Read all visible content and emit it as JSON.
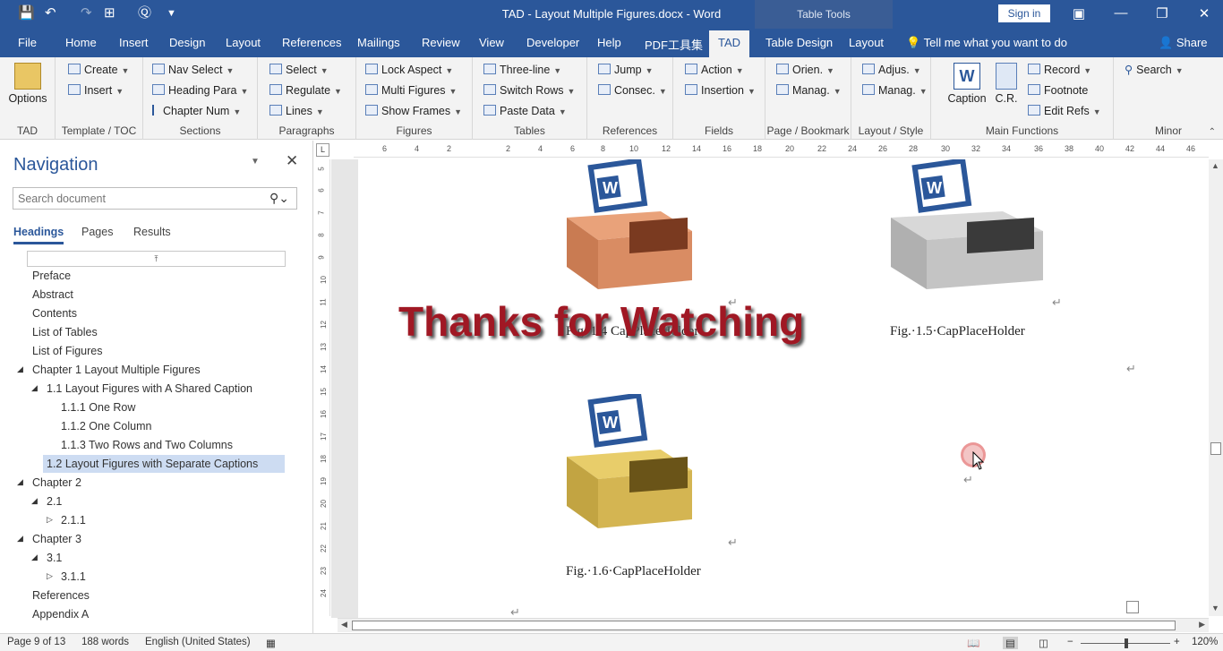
{
  "app": {
    "doc_title": "TAD - Layout Multiple Figures.docx  -  Word",
    "table_tools": "Table Tools",
    "sign_in": "Sign in"
  },
  "tabs": [
    "File",
    "Home",
    "Insert",
    "Design",
    "Layout",
    "References",
    "Mailings",
    "Review",
    "View",
    "Developer",
    "Help",
    "PDF工具集",
    "TAD",
    "Table Design",
    "Layout"
  ],
  "active_tab": "TAD",
  "tell_me": "Tell me what you want to do",
  "share": "Share",
  "ribbon": {
    "groups": {
      "tad": "TAD",
      "template": "Template / TOC",
      "sections": "Sections",
      "paragraphs": "Paragraphs",
      "figures": "Figures",
      "tables": "Tables",
      "references": "References",
      "fields": "Fields",
      "page": "Page / Bookmark",
      "layout": "Layout / Style",
      "main": "Main Functions",
      "minor": "Minor"
    },
    "options": "Options",
    "create": "Create",
    "insert": "Insert",
    "nav_select": "Nav Select",
    "heading_para": "Heading Para",
    "chapter_num": "Chapter Num",
    "select": "Select",
    "regulate": "Regulate",
    "lines": "Lines",
    "lock_aspect": "Lock Aspect",
    "multi_figures": "Multi Figures",
    "show_frames": "Show Frames",
    "three_line": "Three-line",
    "switch_rows": "Switch Rows",
    "paste_data": "Paste Data",
    "jump": "Jump",
    "consec": "Consec.",
    "action": "Action",
    "insertion": "Insertion",
    "orien": "Orien.",
    "manag_page": "Manag.",
    "adjus": "Adjus.",
    "manag_layout": "Manag.",
    "caption": "Caption",
    "cr": "C.R.",
    "record": "Record",
    "footnote": "Footnote",
    "edit_refs": "Edit Refs",
    "search": "Search"
  },
  "nav": {
    "title": "Navigation",
    "search_placeholder": "Search document",
    "tabs": [
      "Headings",
      "Pages",
      "Results"
    ],
    "headings": [
      "Preface",
      "Abstract",
      "Contents",
      "List of Tables",
      "List of Figures",
      "Chapter 1 Layout Multiple Figures",
      "1.1 Layout Figures with A Shared Caption",
      "1.1.1 One Row",
      "1.1.2 One Column",
      "1.1.3 Two Rows and Two Columns",
      "1.2 Layout Figures with Separate Captions",
      "Chapter 2",
      "2.1",
      "2.1.1",
      "Chapter 3",
      "3.1",
      "3.1.1",
      "References",
      "Appendix A"
    ]
  },
  "ruler": {
    "h": [
      "6",
      "4",
      "2",
      "",
      "2",
      "4",
      "6",
      "8",
      "10",
      "12",
      "14",
      "16",
      "18",
      "20",
      "22",
      "24",
      "26",
      "28",
      "30",
      "32",
      "34",
      "36",
      "38",
      "40",
      "42",
      "44",
      "46"
    ],
    "v": [
      "5",
      "6",
      "7",
      "8",
      "9",
      "10",
      "11",
      "12",
      "13",
      "14",
      "15",
      "16",
      "17",
      "18",
      "19",
      "20",
      "21",
      "22",
      "23",
      "24",
      "25"
    ]
  },
  "document": {
    "caption_1": "Fig. 1.4 CapPlaceHolder",
    "caption_2": "Fig.·1.5·CapPlaceHolder",
    "caption_3": "Fig.·1.6·CapPlaceHolder",
    "overlay": "Thanks for Watching",
    "pilcrow": "↵"
  },
  "status": {
    "page": "Page 9 of 13",
    "words": "188 words",
    "language": "English (United States)",
    "zoom": "120%"
  },
  "colors": {
    "brand": "#2b579a",
    "overlay_text": "#a01824"
  }
}
